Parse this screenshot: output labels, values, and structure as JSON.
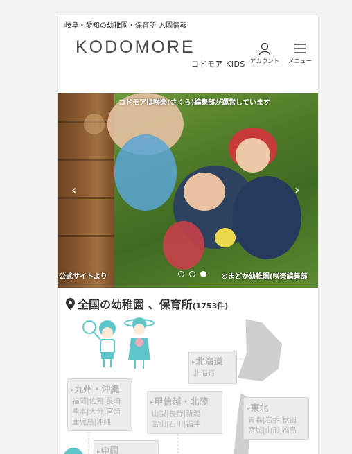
{
  "header": {
    "tagline": "岐阜・愛知の幼稚園・保育所 入園情報",
    "logo": "KODOMORE",
    "brand_sub": "コドモア KIDS",
    "account_label": "アカウント",
    "menu_label": "メニュー"
  },
  "hero": {
    "caption": "コドモアは咲楽(さくら)編集部が運営しています",
    "credit_left": "公式サイトより",
    "credit_right": "©まどか幼稚園(咲楽編集部",
    "slide_count": 3,
    "active_slide": 3
  },
  "section": {
    "title": "全国の幼稚園 、保育所",
    "count": "(1753件)"
  },
  "regions": {
    "hokkaido": {
      "name": "北海道",
      "prefs": "北海道"
    },
    "kyushu": {
      "name": "九州・沖縄",
      "prefs": [
        "福岡|佐賀|長崎",
        "熊本|大分|宮崎",
        "鹿児島|沖縄"
      ]
    },
    "koshinetsu": {
      "name": "甲信越・北陸",
      "prefs": [
        "山梨|長野|新潟",
        "富山|石川|福井"
      ]
    },
    "tohoku": {
      "name": "東北",
      "prefs": [
        "青森|岩手|秋田",
        "宮城|山形|福島"
      ]
    },
    "chugoku": {
      "name": "中国"
    }
  },
  "colors": {
    "accent": "#5cc6c8",
    "map_land": "#cfcfcf",
    "region_box": "#ececec"
  }
}
